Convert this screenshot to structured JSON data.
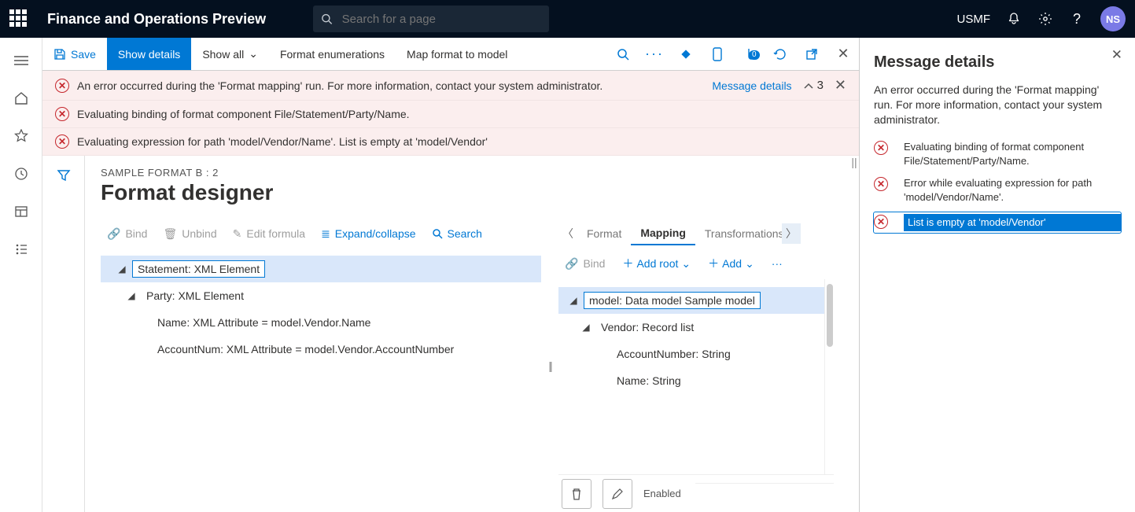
{
  "header": {
    "app_title": "Finance and Operations Preview",
    "search_placeholder": "Search for a page",
    "company": "USMF",
    "avatar_initials": "NS"
  },
  "actionbar": {
    "save": "Save",
    "show_details": "Show details",
    "show_all": "Show all",
    "format_enum": "Format enumerations",
    "map_format": "Map format to model",
    "attach_count": "0"
  },
  "errors": {
    "link_label": "Message details",
    "count": "3",
    "items": [
      "An error occurred during the 'Format mapping' run. For more information, contact your system administrator.",
      "Evaluating binding of format component File/Statement/Party/Name.",
      "Evaluating expression for path 'model/Vendor/Name'.   List is empty at 'model/Vendor'"
    ]
  },
  "designer": {
    "crumb": "SAMPLE FORMAT B : 2",
    "title": "Format designer",
    "left_toolbar": {
      "bind": "Bind",
      "unbind": "Unbind",
      "edit_formula": "Edit formula",
      "expand": "Expand/collapse",
      "search": "Search"
    },
    "left_tree": {
      "n0": "Statement: XML Element",
      "n1": "Party: XML Element",
      "n2": "Name: XML Attribute = model.Vendor.Name",
      "n3": "AccountNum: XML Attribute = model.Vendor.AccountNumber"
    },
    "right_tabs": {
      "format": "Format",
      "mapping": "Mapping",
      "transform": "Transformations"
    },
    "right_toolbar": {
      "bind": "Bind",
      "add_root": "Add root",
      "add": "Add"
    },
    "right_tree": {
      "r0": "model: Data model Sample model",
      "r1": "Vendor: Record list",
      "r2": "AccountNumber: String",
      "r3": "Name: String"
    },
    "bottom": {
      "enabled": "Enabled"
    }
  },
  "msgpanel": {
    "title": "Message details",
    "desc": "An error occurred during the 'Format mapping' run. For more information, contact your system administrator.",
    "items": [
      "Evaluating binding of format component File/Statement/Party/Name.",
      "Error while evaluating expression for path 'model/Vendor/Name'.",
      "List is empty at 'model/Vendor'"
    ]
  }
}
